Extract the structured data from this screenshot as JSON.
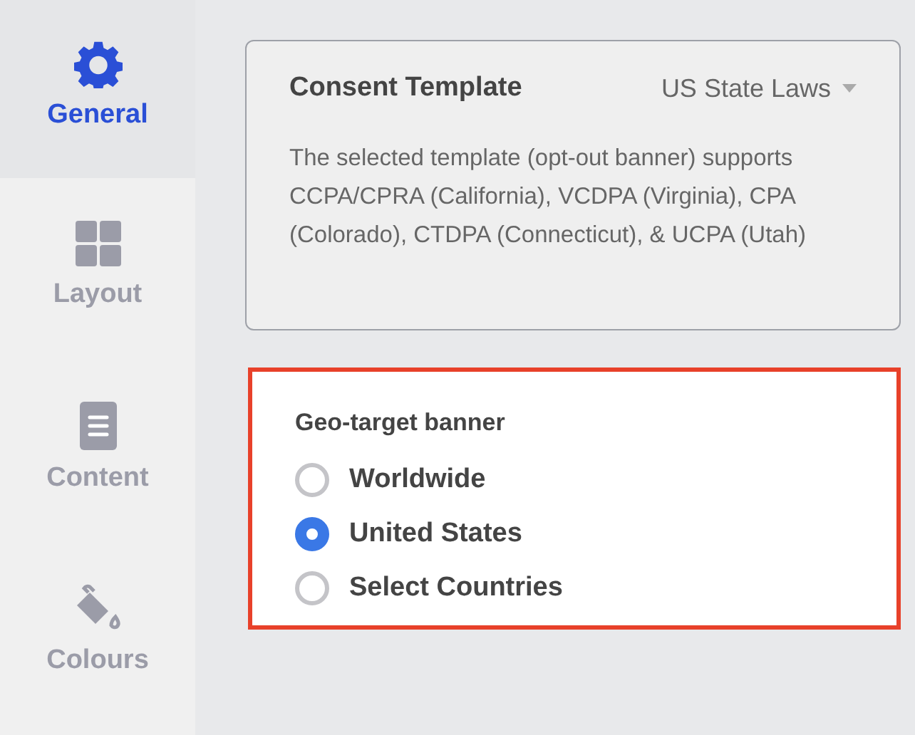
{
  "sidebar": {
    "items": [
      {
        "kind": "gear",
        "label": "General",
        "selected": true
      },
      {
        "kind": "grid",
        "label": "Layout",
        "selected": false
      },
      {
        "kind": "document",
        "label": "Content",
        "selected": false
      },
      {
        "kind": "paint",
        "label": "Colours",
        "selected": false
      }
    ]
  },
  "consent_template": {
    "title": "Consent Template",
    "dropdown": {
      "value": "US State Laws"
    },
    "description": "The selected template (opt-out banner) supports CCPA/CPRA (California), VCDPA (Virginia), CPA (Colorado), CTDPA (Connecticut), & UCPA (Utah)"
  },
  "geo_target": {
    "title": "Geo-target banner",
    "highlighted": true,
    "options": [
      {
        "label": "Worldwide",
        "selected": false
      },
      {
        "label": "United States",
        "selected": true
      },
      {
        "label": "Select Countries",
        "selected": false
      }
    ]
  }
}
